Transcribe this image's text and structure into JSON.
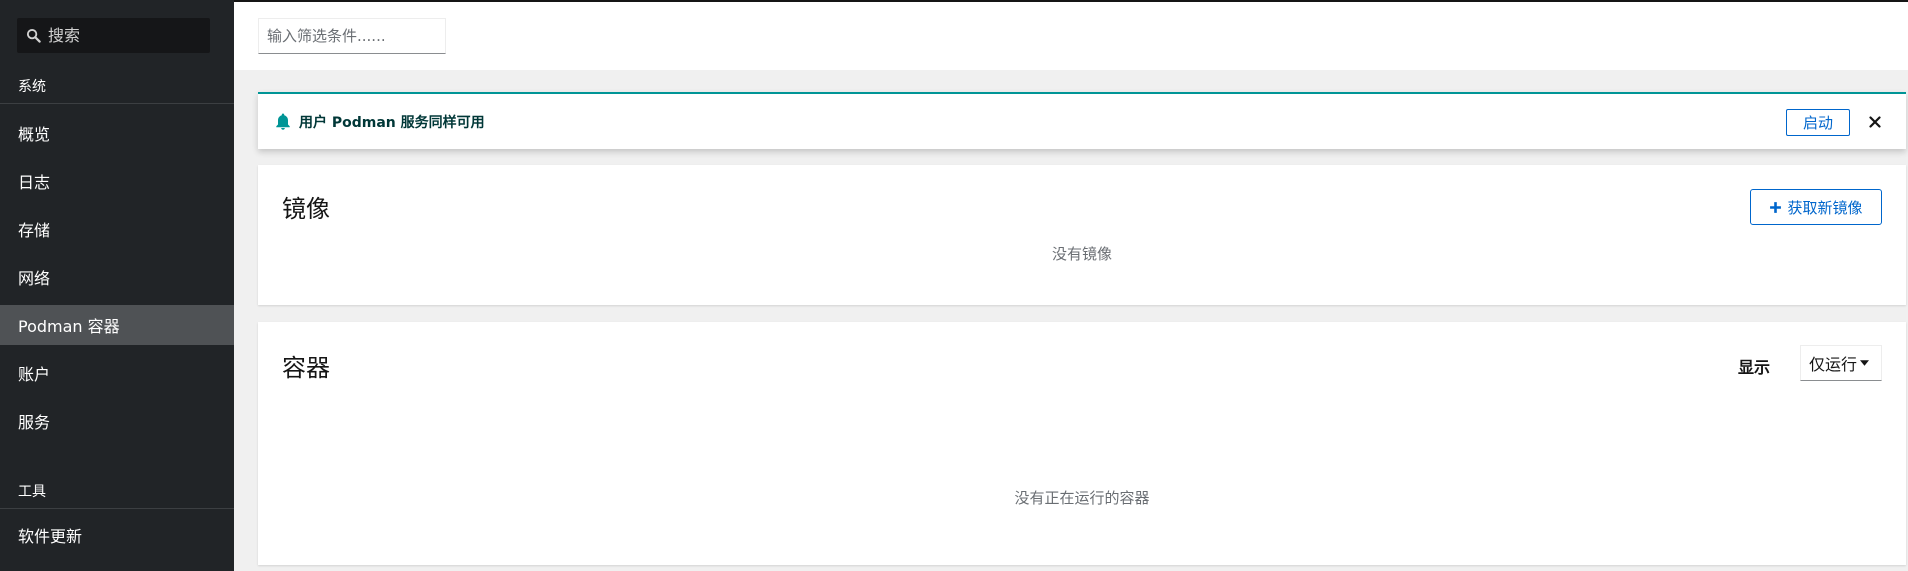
{
  "sidebar": {
    "search_placeholder": "搜索",
    "sections": [
      {
        "title": "系统",
        "items": [
          {
            "label": "概览"
          },
          {
            "label": "日志"
          },
          {
            "label": "存储"
          },
          {
            "label": "网络"
          },
          {
            "label": "Podman 容器",
            "active": true
          },
          {
            "label": "账户"
          },
          {
            "label": "服务"
          }
        ]
      },
      {
        "title": "工具",
        "items": [
          {
            "label": "软件更新"
          }
        ]
      }
    ]
  },
  "filter": {
    "placeholder": "输入筛选条件......"
  },
  "alert": {
    "icon": "bell-icon",
    "title": "用户 Podman 服务同样可用",
    "start_label": "启动",
    "accent_color": "#009596"
  },
  "images": {
    "title": "镜像",
    "pull_label": "获取新镜像",
    "empty_text": "没有镜像"
  },
  "containers": {
    "title": "容器",
    "show_label": "显示",
    "show_value": "仅运行",
    "empty_text": "没有正在运行的容器"
  },
  "colors": {
    "sidebar_bg": "#212427",
    "active_item_bg": "#4f5255",
    "link_blue": "#0066cc"
  }
}
